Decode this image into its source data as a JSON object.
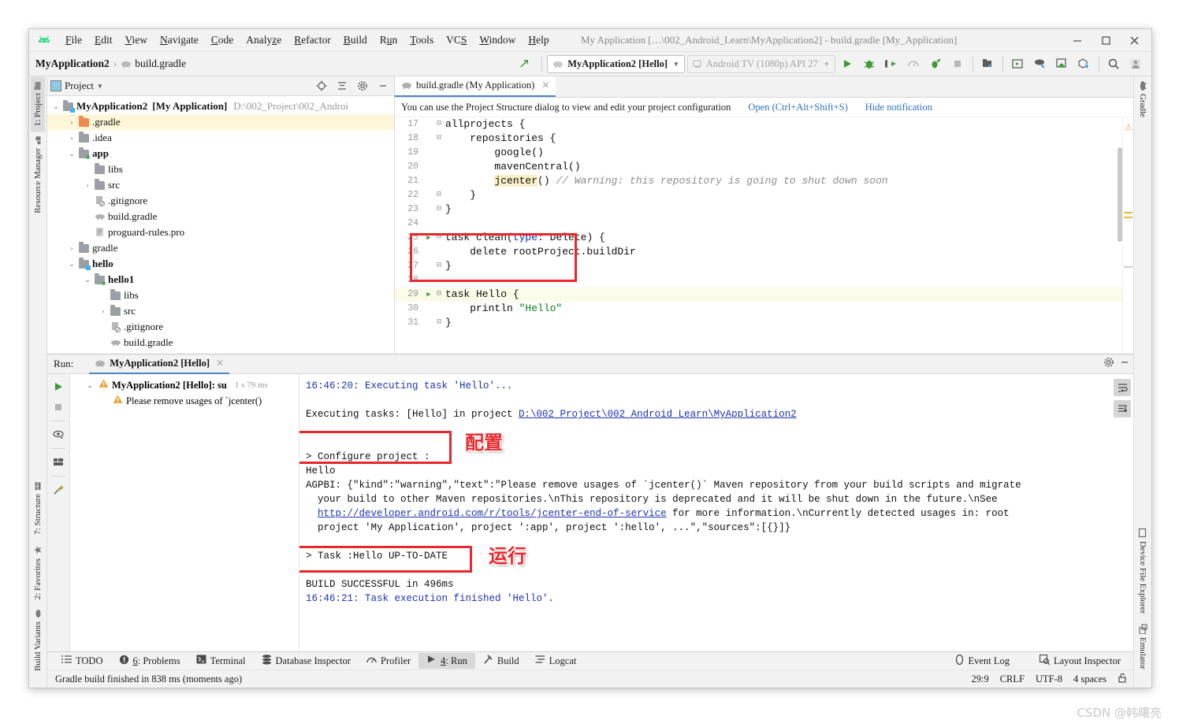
{
  "window": {
    "title": "My Application […\\002_Android_Learn\\MyApplication2] - build.gradle [My_Application]",
    "minimize": "—",
    "maximize": "□",
    "close": "✕"
  },
  "menu": [
    "File",
    "Edit",
    "View",
    "Navigate",
    "Code",
    "Analyze",
    "Refactor",
    "Build",
    "Run",
    "Tools",
    "VCS",
    "Window",
    "Help"
  ],
  "toolbar": {
    "breadcrumb_project": "MyApplication2",
    "breadcrumb_sep": "›",
    "breadcrumb_file": "build.gradle",
    "run_config": "MyApplication2 [Hello]",
    "device": "Android TV (1080p) API 27",
    "caret": "▼",
    "icons": [
      "run-icon",
      "debug-icon",
      "attach-debugger-icon",
      "profiler-icon",
      "run-with-coverage-icon",
      "stop-icon",
      "sdk-manager-icon",
      "avd-manager-icon",
      "sync-gradle-icon",
      "device-manager-icon",
      "install-icon",
      "search-icon",
      "account-icon"
    ]
  },
  "left_strip": [
    {
      "label": "1: Project",
      "selected": true,
      "icon": "folder-icon"
    },
    {
      "label": "Resource Manager",
      "selected": false,
      "icon": "resource-icon"
    },
    {
      "label": "7: Structure",
      "selected": false,
      "icon": "structure-icon"
    },
    {
      "label": "2: Favorites",
      "selected": false,
      "icon": "star-icon"
    },
    {
      "label": "Build Variants",
      "selected": false,
      "icon": "variants-icon"
    }
  ],
  "right_strip": [
    {
      "label": "Gradle",
      "icon": "gradle-elephant-icon"
    },
    {
      "label": "Device File Explorer",
      "icon": "device-icon"
    },
    {
      "label": "Emulator",
      "icon": "emulator-icon"
    }
  ],
  "project_panel": {
    "title": "Project",
    "caret": "▼",
    "header_icons": [
      "locate-icon",
      "collapse-all-icon",
      "settings-gear-icon",
      "hide-icon"
    ],
    "tree": [
      {
        "indent": 0,
        "arrow": "v",
        "icon": "module-folder",
        "label": "MyApplication2",
        "bold": true,
        "suffix": "[My Application]",
        "path": "D:\\002_Project\\002_Androi",
        "highlight": false
      },
      {
        "indent": 1,
        "arrow": ">",
        "icon": "folder-orange",
        "label": ".gradle",
        "bold": false,
        "suffix": "",
        "path": "",
        "highlight": true
      },
      {
        "indent": 1,
        "arrow": ">",
        "icon": "folder",
        "label": ".idea",
        "bold": false,
        "suffix": "",
        "path": "",
        "highlight": false
      },
      {
        "indent": 1,
        "arrow": "v",
        "icon": "module-folder-green",
        "label": "app",
        "bold": true,
        "suffix": "",
        "path": "",
        "highlight": false
      },
      {
        "indent": 2,
        "arrow": "",
        "icon": "folder",
        "label": "libs",
        "bold": false,
        "suffix": "",
        "path": "",
        "highlight": false
      },
      {
        "indent": 2,
        "arrow": ">",
        "icon": "folder",
        "label": "src",
        "bold": false,
        "suffix": "",
        "path": "",
        "highlight": false
      },
      {
        "indent": 2,
        "arrow": "",
        "icon": "gitignore-file",
        "label": ".gitignore",
        "bold": false,
        "suffix": "",
        "path": "",
        "highlight": false
      },
      {
        "indent": 2,
        "arrow": "",
        "icon": "gradle-file",
        "label": "build.gradle",
        "bold": false,
        "suffix": "",
        "path": "",
        "highlight": false
      },
      {
        "indent": 2,
        "arrow": "",
        "icon": "text-file",
        "label": "proguard-rules.pro",
        "bold": false,
        "suffix": "",
        "path": "",
        "highlight": false
      },
      {
        "indent": 1,
        "arrow": ">",
        "icon": "folder",
        "label": "gradle",
        "bold": false,
        "suffix": "",
        "path": "",
        "highlight": false
      },
      {
        "indent": 1,
        "arrow": "v",
        "icon": "module-folder-blue",
        "label": "hello",
        "bold": true,
        "suffix": "",
        "path": "",
        "highlight": false
      },
      {
        "indent": 2,
        "arrow": "v",
        "icon": "module-folder-green",
        "label": "hello1",
        "bold": true,
        "suffix": "",
        "path": "",
        "highlight": false
      },
      {
        "indent": 3,
        "arrow": "",
        "icon": "folder",
        "label": "libs",
        "bold": false,
        "suffix": "",
        "path": "",
        "highlight": false
      },
      {
        "indent": 3,
        "arrow": ">",
        "icon": "folder",
        "label": "src",
        "bold": false,
        "suffix": "",
        "path": "",
        "highlight": false
      },
      {
        "indent": 3,
        "arrow": "",
        "icon": "gitignore-file",
        "label": ".gitignore",
        "bold": false,
        "suffix": "",
        "path": "",
        "highlight": false
      },
      {
        "indent": 3,
        "arrow": "",
        "icon": "gradle-file",
        "label": "build.gradle",
        "bold": false,
        "suffix": "",
        "path": "",
        "highlight": false
      }
    ]
  },
  "editor": {
    "tab_label": "build.gradle (My Application)",
    "tab_close": "✕",
    "notification": {
      "text": "You can use the Project Structure dialog to view and edit your project configuration",
      "open_link": "Open (Ctrl+Alt+Shift+S)",
      "hide_link": "Hide notification"
    },
    "lines": [
      {
        "n": 17,
        "run": false,
        "fold": "⊟",
        "indent": 0,
        "text": "allprojects {",
        "hl": false
      },
      {
        "n": 18,
        "run": false,
        "fold": "⊟",
        "indent": 1,
        "text": "repositories {",
        "hl": false
      },
      {
        "n": 19,
        "run": false,
        "fold": "",
        "indent": 2,
        "text": "google()",
        "hl": false
      },
      {
        "n": 20,
        "run": false,
        "fold": "",
        "indent": 2,
        "text": "mavenCentral()",
        "hl": false
      },
      {
        "n": 21,
        "run": false,
        "fold": "",
        "indent": 2,
        "text": "jcenter() // Warning: this repository is going to shut down soon",
        "hl": false
      },
      {
        "n": 22,
        "run": false,
        "fold": "⊟",
        "indent": 1,
        "text": "}",
        "hl": false
      },
      {
        "n": 23,
        "run": false,
        "fold": "⊟",
        "indent": 0,
        "text": "}",
        "hl": false
      },
      {
        "n": 24,
        "run": false,
        "fold": "",
        "indent": 0,
        "text": "",
        "hl": false
      },
      {
        "n": 25,
        "run": true,
        "fold": "⊟",
        "indent": 0,
        "text": "task clean(type: Delete) {",
        "hl": false
      },
      {
        "n": 26,
        "run": false,
        "fold": "",
        "indent": 1,
        "text": "delete rootProject.buildDir",
        "hl": false
      },
      {
        "n": 27,
        "run": false,
        "fold": "⊟",
        "indent": 0,
        "text": "}",
        "hl": false
      },
      {
        "n": 28,
        "run": false,
        "fold": "",
        "indent": 0,
        "text": "",
        "hl": false
      },
      {
        "n": 29,
        "run": true,
        "fold": "⊟",
        "indent": 0,
        "text": "task Hello {",
        "hl": true
      },
      {
        "n": 30,
        "run": false,
        "fold": "",
        "indent": 1,
        "text": "println \"Hello\"",
        "hl": false
      },
      {
        "n": 31,
        "run": false,
        "fold": "⊟",
        "indent": 0,
        "text": "}",
        "hl": false
      }
    ]
  },
  "run_panel": {
    "label": "Run:",
    "tab": "MyApplication2 [Hello]",
    "tab_close": "✕",
    "header_icons": [
      "settings-gear-icon",
      "minimize-icon"
    ],
    "side_icons": [
      "rerun-icon",
      "stop-icon",
      "toggle-view-icon",
      "layout-icon",
      "pin-icon"
    ],
    "console_right_icons": [
      "soft-wrap-icon",
      "scroll-to-end-icon"
    ],
    "tree": [
      {
        "arrow": "v",
        "icon": "warning-icon",
        "label": "MyApplication2 [Hello]: su",
        "duration": "1 s 79 ms",
        "indent": 0
      },
      {
        "arrow": "",
        "icon": "warning-icon",
        "label": "Please remove usages of `jcenter()",
        "duration": "",
        "indent": 1
      }
    ],
    "console": [
      {
        "text": "16:46:20: Executing task 'Hello'...",
        "style": "blue"
      },
      {
        "text": "",
        "style": "plain"
      },
      {
        "text": "Executing tasks: [Hello] in project ",
        "style": "plain",
        "link": "D:\\002_Project\\002_Android_Learn\\MyApplication2"
      },
      {
        "text": "",
        "style": "plain"
      },
      {
        "text": "",
        "style": "plain"
      },
      {
        "text": "> Configure project :",
        "style": "plain"
      },
      {
        "text": "Hello",
        "style": "plain"
      },
      {
        "text": "AGPBI: {\"kind\":\"warning\",\"text\":\"Please remove usages of `jcenter()` Maven repository from your build scripts and migrate",
        "style": "plain"
      },
      {
        "text": "  your build to other Maven repositories.\\nThis repository is deprecated and it will be shut down in the future.\\nSee",
        "style": "plain"
      },
      {
        "text": "  ",
        "style": "plain",
        "link": "http://developer.android.com/r/tools/jcenter-end-of-service",
        "after": " for more information.\\nCurrently detected usages in: root"
      },
      {
        "text": "  project 'My Application', project ':app', project ':hello', ...\",\"sources\":[{}]}",
        "style": "plain"
      },
      {
        "text": "",
        "style": "plain"
      },
      {
        "text": "> Task :Hello UP-TO-DATE",
        "style": "plain"
      },
      {
        "text": "",
        "style": "plain"
      },
      {
        "text": "BUILD SUCCESSFUL in 496ms",
        "style": "plain"
      },
      {
        "text": "16:46:21: Task execution finished 'Hello'.",
        "style": "blue"
      }
    ],
    "annotations": [
      {
        "text": "配置",
        "meaning": "configure"
      },
      {
        "text": "运行",
        "meaning": "run"
      }
    ]
  },
  "bottom_tabs": [
    {
      "label": "TODO",
      "icon": "todo-icon",
      "selected": false,
      "mnemonic": ""
    },
    {
      "label": ": Problems",
      "icon": "problems-icon",
      "selected": false,
      "mnemonic": "6"
    },
    {
      "label": "Terminal",
      "icon": "terminal-icon",
      "selected": false,
      "mnemonic": ""
    },
    {
      "label": "Database Inspector",
      "icon": "database-icon",
      "selected": false,
      "mnemonic": ""
    },
    {
      "label": "Profiler",
      "icon": "profiler-icon",
      "selected": false,
      "mnemonic": ""
    },
    {
      "label": ": Run",
      "icon": "run-icon",
      "selected": true,
      "mnemonic": "4"
    },
    {
      "label": "Build",
      "icon": "build-hammer-icon",
      "selected": false,
      "mnemonic": ""
    },
    {
      "label": "Logcat",
      "icon": "logcat-icon",
      "selected": false,
      "mnemonic": ""
    }
  ],
  "bottom_right_tabs": [
    {
      "label": "Event Log",
      "icon": "event-log-icon"
    },
    {
      "label": "Layout Inspector",
      "icon": "layout-inspector-icon"
    }
  ],
  "status": {
    "message": "Gradle build finished in 838 ms (moments ago)",
    "caret_position": "29:9",
    "line_separator": "CRLF",
    "encoding": "UTF-8",
    "indent": "4 spaces",
    "lock_icon": "unlocked-icon"
  },
  "watermark": "CSDN @韩曙亮",
  "colors": {
    "accent_blue": "#4a86c8",
    "link": "#2f6fbb",
    "annotation_red": "#e8272c",
    "keyword": "#0033b3",
    "string": "#067d17",
    "green_run": "#3f9c35"
  }
}
